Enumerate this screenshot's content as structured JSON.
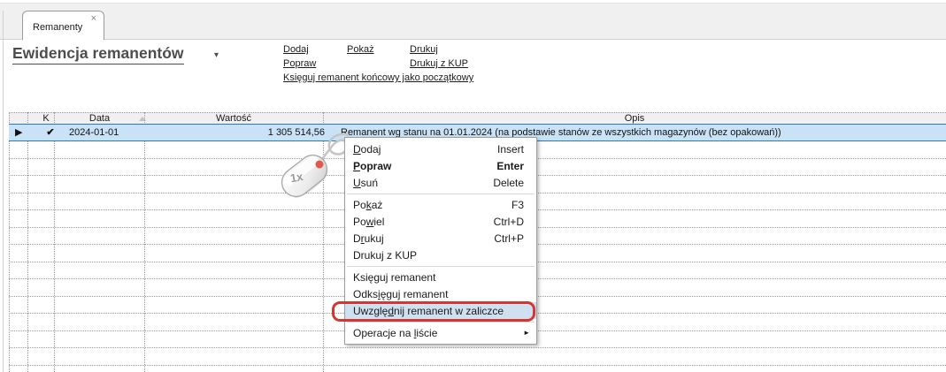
{
  "tab": {
    "label": "Remanenty",
    "close_icon": "×"
  },
  "header": {
    "title": "Ewidencja remanentów",
    "dropdown_icon": "▾"
  },
  "actions": {
    "dodaj": "Dodaj",
    "popraw": "Popraw",
    "pokaz": "Pokaż",
    "drukuj": "Drukuj",
    "drukuj_z_kup": "Drukuj z KUP",
    "ksieguj_koncowy": "Księguj remanent końcowy jako początkowy"
  },
  "table": {
    "columns": {
      "k": "K",
      "data": "Data",
      "wartosc": "Wartość",
      "opis": "Opis"
    },
    "row": {
      "selector_icon": "▶",
      "k_check_icon": "✔",
      "data": "2024-01-01",
      "wartosc": "1 305 514,56",
      "opis": "Remanent wg stanu na 01.01.2024 (na podstawie stanów ze wszystkich magazynów (bez opakowań))"
    }
  },
  "context_menu": {
    "items": [
      {
        "pre": "",
        "accel": "D",
        "post": "odaj",
        "shortcut": "Insert"
      },
      {
        "pre": "",
        "accel": "P",
        "post": "opraw",
        "shortcut": "Enter"
      },
      {
        "pre": "",
        "accel": "U",
        "post": "suń",
        "shortcut": "Delete"
      },
      {
        "pre": "Po",
        "accel": "k",
        "post": "aż",
        "shortcut": "F3"
      },
      {
        "pre": "Po",
        "accel": "w",
        "post": "iel",
        "shortcut": "Ctrl+D"
      },
      {
        "pre": "D",
        "accel": "r",
        "post": "ukuj",
        "shortcut": "Ctrl+P"
      },
      {
        "pre": "Druku",
        "accel": "j",
        "post": " z KUP",
        "shortcut": ""
      },
      {
        "pre": "Księ",
        "accel": "g",
        "post": "uj remanent",
        "shortcut": ""
      },
      {
        "pre": "Odks",
        "accel": "i",
        "post": "ęguj remanent",
        "shortcut": ""
      },
      {
        "pre": "Uwzglę",
        "accel": "d",
        "post": "nij remanent w zaliczce",
        "shortcut": ""
      },
      {
        "pre": "Operacje na ",
        "accel": "l",
        "post": "iście",
        "shortcut": ""
      }
    ],
    "submenu_arrow_icon": "►"
  },
  "annotation": {
    "click_count_label": "1x",
    "highlight_color": "#d43632",
    "selection_fill": "#c9e2f6",
    "selection_border": "#2878c8"
  }
}
